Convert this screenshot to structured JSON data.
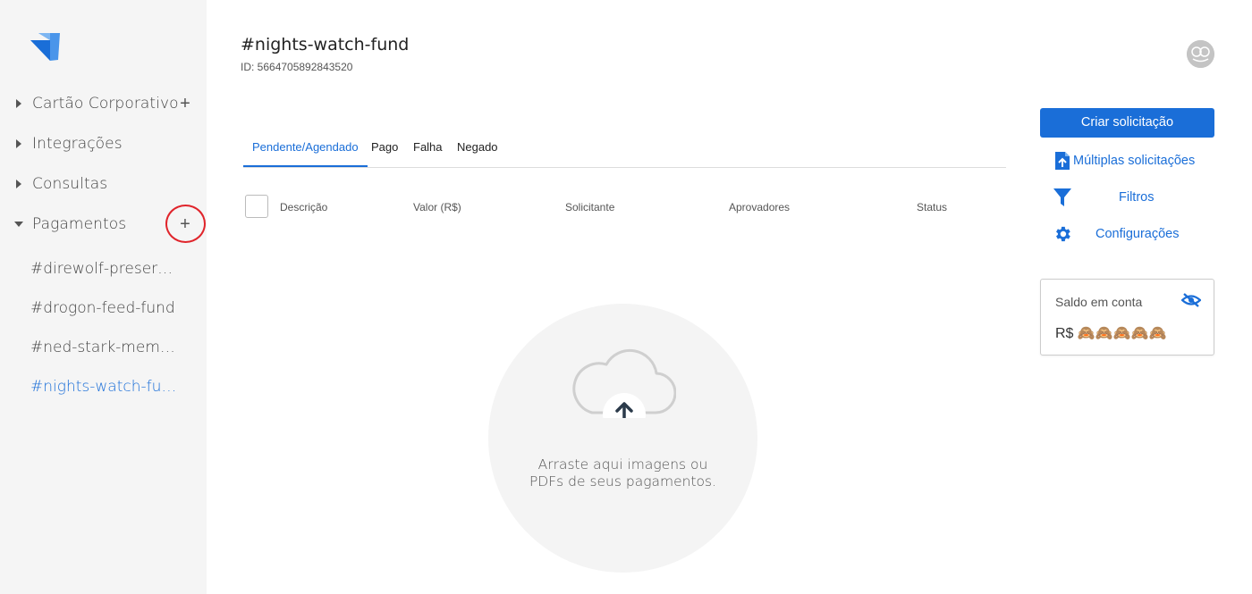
{
  "sidebar": {
    "nav": [
      {
        "label": "Cartão Corporativo",
        "expanded": false,
        "has_add": true
      },
      {
        "label": "Integrações",
        "expanded": false,
        "has_add": false
      },
      {
        "label": "Consultas",
        "expanded": false,
        "has_add": false
      },
      {
        "label": "Pagamentos",
        "expanded": true,
        "has_add": true
      }
    ],
    "add_symbol": "+",
    "channels": [
      {
        "label": "#direwolf-preservation-fund",
        "active": false
      },
      {
        "label": "#drogon-feed-fund",
        "active": false
      },
      {
        "label": "#ned-stark-memorial-fund",
        "active": false
      },
      {
        "label": "#nights-watch-fund",
        "active": true
      }
    ]
  },
  "header": {
    "title": "#nights-watch-fund",
    "id_text": "ID: 5664705892843520"
  },
  "tabs": [
    {
      "label": "Pendente/Agendado",
      "active": true
    },
    {
      "label": "Pago",
      "active": false
    },
    {
      "label": "Falha",
      "active": false
    },
    {
      "label": "Negado",
      "active": false
    }
  ],
  "table": {
    "columns": [
      "Descrição",
      "Valor (R$)",
      "Solicitante",
      "Aprovadores",
      "Status"
    ]
  },
  "dropzone": {
    "text": "Arraste aqui imagens ou PDFs de seus pagamentos."
  },
  "actions": {
    "primary_label": "Criar solicitação",
    "links": [
      {
        "label": "Múltiplas solicitações",
        "icon": "file-upload-icon"
      },
      {
        "label": "Filtros",
        "icon": "filter-icon"
      },
      {
        "label": "Configurações",
        "icon": "gear-icon"
      }
    ]
  },
  "balance": {
    "label": "Saldo em conta",
    "value": "R$ 🙈🙈🙈🙈🙈"
  },
  "colors": {
    "accent": "#1a6ed8",
    "sidebar_bg": "#f5f5f5",
    "highlight": "#e0242b"
  }
}
